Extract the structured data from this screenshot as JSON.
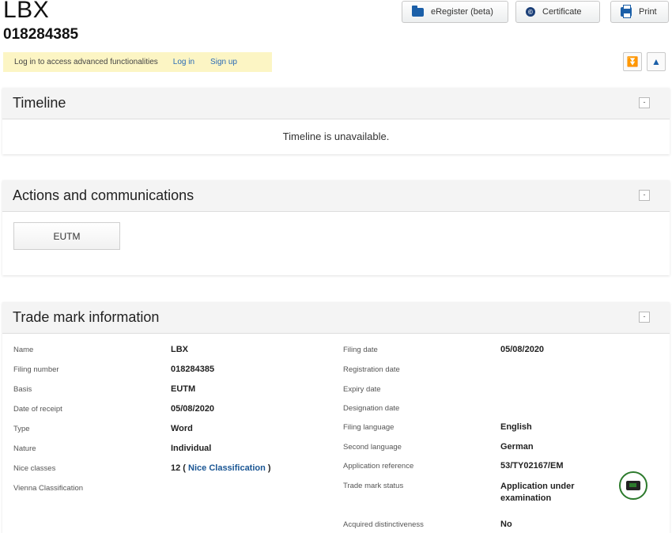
{
  "header": {
    "title": "LBX",
    "number": "018284385",
    "buttons": {
      "eregister": "eRegister (beta)",
      "certificate": "Certificate",
      "print": "Print"
    }
  },
  "login_bar": {
    "message": "Log in to access advanced functionalities",
    "login": "Log in",
    "signup": "Sign up"
  },
  "timeline": {
    "heading": "Timeline",
    "message": "Timeline is unavailable."
  },
  "actions": {
    "heading": "Actions and communications",
    "tab": "EUTM"
  },
  "trade_mark": {
    "heading": "Trade mark information",
    "left": [
      {
        "label": "Name",
        "value": "LBX"
      },
      {
        "label": "Filing number",
        "value": "018284385"
      },
      {
        "label": "Basis",
        "value": "EUTM"
      },
      {
        "label": "Date of receipt",
        "value": "05/08/2020"
      },
      {
        "label": "Type",
        "value": "Word"
      },
      {
        "label": "Nature",
        "value": "Individual"
      },
      {
        "label": "Nice classes",
        "value": "12 (",
        "link": "Nice Classification",
        "suffix": ")"
      },
      {
        "label": "Vienna Classification",
        "value": ""
      }
    ],
    "right": [
      {
        "label": "Filing date",
        "value": "05/08/2020"
      },
      {
        "label": "Registration date",
        "value": ""
      },
      {
        "label": "Expiry date",
        "value": ""
      },
      {
        "label": "Designation date",
        "value": ""
      },
      {
        "label": "Filing language",
        "value": "English"
      },
      {
        "label": "Second language",
        "value": "German"
      },
      {
        "label": "Application reference",
        "value": "53/TY02167/EM"
      },
      {
        "label": "Trade mark status",
        "value": "Application under examination"
      },
      {
        "label": "Acquired distinctiveness",
        "value": "No"
      }
    ]
  }
}
